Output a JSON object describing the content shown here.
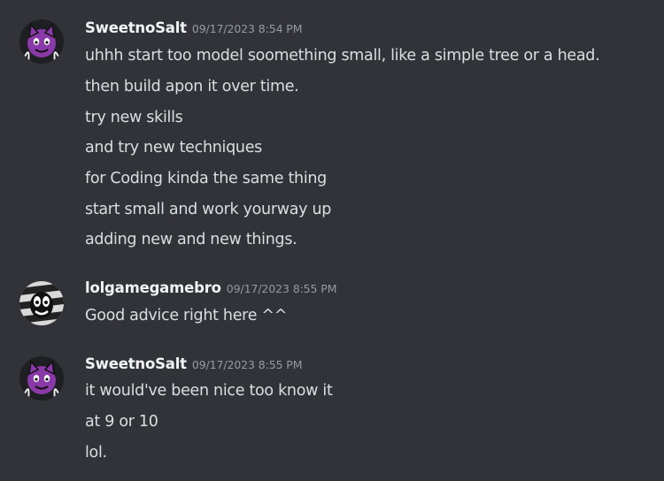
{
  "messages": [
    {
      "author": "SweetnoSalt",
      "timestamp": "09/17/2023 8:54 PM",
      "avatar_icon": "purple-cat-avatar-icon",
      "lines": [
        "uhhh start too model soomething small, like a simple tree or a head.",
        "then build apon it over time.",
        "try new skills",
        "and try new techniques",
        "for Coding kinda the same thing",
        "start small and work yourway up",
        "adding new and new things."
      ]
    },
    {
      "author": "lolgamegamebro",
      "timestamp": "09/17/2023 8:55 PM",
      "avatar_icon": "striped-face-avatar-icon",
      "lines": [
        "Good advice right here ^^"
      ]
    },
    {
      "author": "SweetnoSalt",
      "timestamp": "09/17/2023 8:55 PM",
      "avatar_icon": "purple-cat-avatar-icon",
      "lines": [
        "it would've been nice too know it",
        "at 9 or 10",
        "lol."
      ]
    }
  ],
  "colors": {
    "background": "#313338",
    "username": "#f2f3f5",
    "timestamp": "#949ba4",
    "message_text": "#dbdee1",
    "avatar_purple": "#8a3aa8"
  }
}
